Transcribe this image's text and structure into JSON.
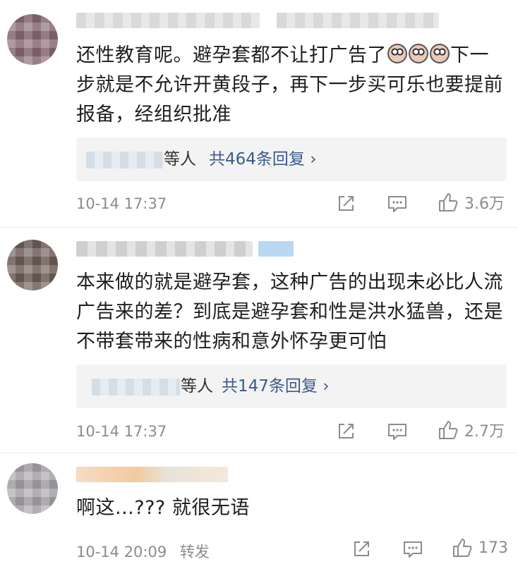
{
  "comments": [
    {
      "text_before": "还性教育呢。避孕套都不让打广告了",
      "emojis": [
        "screaming-face-emoji",
        "screaming-face-emoji",
        "screaming-face-emoji"
      ],
      "text_after": "下一步就是不允许开黄段子，再下一步买可乐也要提前报备，经组织批准",
      "reply_suffix": "等人",
      "reply_count_label": "共464条回复 ›",
      "time": "10-14 17:37",
      "likes": "3.6万"
    },
    {
      "text": "本来做的就是避孕套，这种广告的出现未必比人流广告来的差？到底是避孕套和性是洪水猛兽，还是不带套带来的性病和意外怀孕更可怕",
      "reply_suffix": "等人",
      "reply_count_label": "共147条回复 ›",
      "time": "10-14 17:37",
      "likes": "2.7万"
    },
    {
      "text": "啊这...??? 就很无语",
      "time": "10-14 20:09",
      "forward_label": "转发",
      "likes": "173"
    }
  ],
  "icons": [
    "share-icon",
    "comment-icon",
    "like-icon"
  ]
}
